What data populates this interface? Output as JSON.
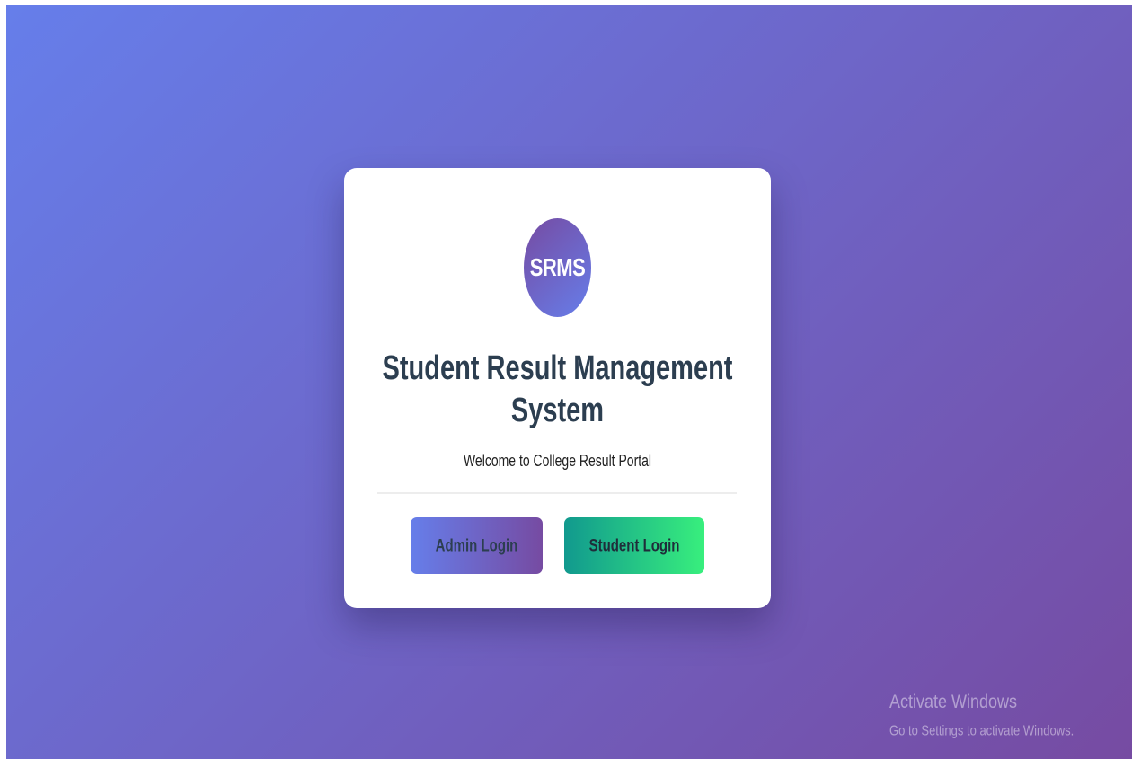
{
  "card": {
    "logo_text": "SRMS",
    "title": "Student Result Management System",
    "subtitle": "Welcome to College Result Portal",
    "buttons": {
      "admin_label": "Admin Login",
      "student_label": "Student Login"
    }
  },
  "watermark": {
    "title": "Activate Windows",
    "subtitle": "Go to Settings to activate Windows."
  },
  "colors": {
    "background_start": "#667eea",
    "background_end": "#764ba2",
    "title_text": "#2c3e50",
    "student_button_start": "#11998e",
    "student_button_end": "#38ef7d"
  }
}
